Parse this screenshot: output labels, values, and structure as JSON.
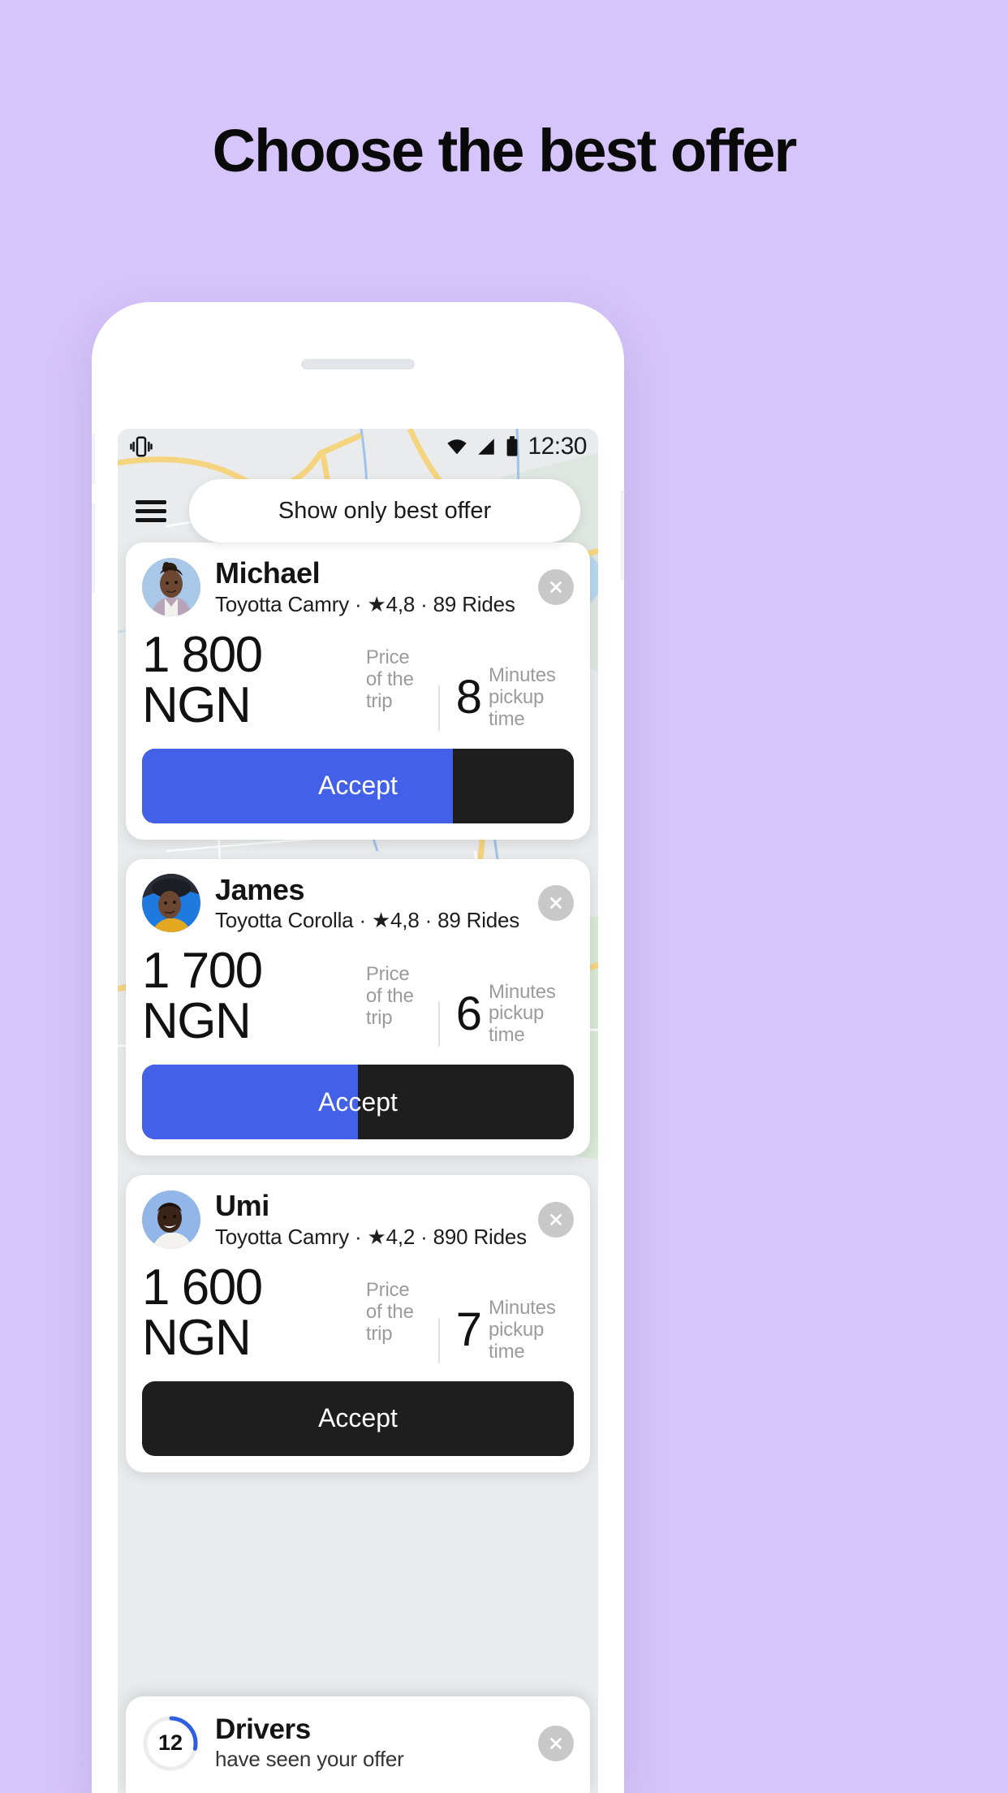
{
  "headline": "Choose the best offer",
  "theme": {
    "background": "#d6c5fa",
    "accent_blue": "#4361e8",
    "button_dark": "#1e1e1e",
    "muted_text": "#9b9b9b"
  },
  "status_bar": {
    "vibrate_icon": "vibrate-icon",
    "wifi_icon": "wifi-icon",
    "signal_icon": "signal-icon",
    "battery_icon": "battery-icon",
    "time": "12:30"
  },
  "top_bar": {
    "menu_icon": "hamburger-menu-icon",
    "best_offer_label": "Show only best offer"
  },
  "offers": [
    {
      "name": "Michael",
      "meta": "Toyotta Camry · ★4,8 · 89 Rides",
      "car": "Toyotta Camry",
      "rating": "4,8",
      "rides": "89 Rides",
      "price": "1 800 NGN",
      "price_label_line1": "Price",
      "price_label_line2": "of the trip",
      "minutes": "8",
      "minutes_label_line1": "Minutes",
      "minutes_label_line2": "pickup time",
      "accept_label": "Accept",
      "progress_percent": 72,
      "close_icon": "close-icon"
    },
    {
      "name": "James",
      "meta": "Toyotta Corolla · ★4,8 · 89 Rides",
      "car": "Toyotta Corolla",
      "rating": "4,8",
      "rides": "89 Rides",
      "price": "1 700 NGN",
      "price_label_line1": "Price",
      "price_label_line2": "of the trip",
      "minutes": "6",
      "minutes_label_line1": "Minutes",
      "minutes_label_line2": "pickup time",
      "accept_label": "Accept",
      "progress_percent": 50,
      "close_icon": "close-icon"
    },
    {
      "name": "Umi",
      "meta": "Toyotta Camry · ★4,2 · 890 Rides",
      "car": "Toyotta Camry",
      "rating": "4,2",
      "rides": "890 Rides",
      "price": "1 600 NGN",
      "price_label_line1": "Price",
      "price_label_line2": "of the trip",
      "minutes": "7",
      "minutes_label_line1": "Minutes",
      "minutes_label_line2": "pickup time",
      "accept_label": "Accept",
      "progress_percent": 0,
      "close_icon": "close-icon"
    }
  ],
  "drivers_sheet": {
    "count": "12",
    "title": "Drivers",
    "subtitle": "have seen your offer",
    "close_icon": "close-icon",
    "ring_progress_percent": 28
  }
}
